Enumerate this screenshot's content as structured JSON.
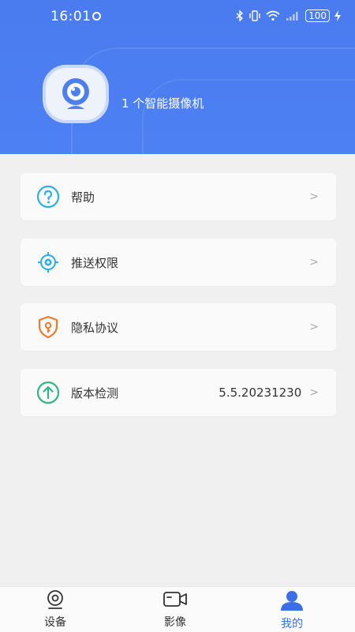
{
  "status_bar": {
    "time": "16:01",
    "battery": "100"
  },
  "header": {
    "device_count_label": "1 个智能摄像机"
  },
  "menu": {
    "items": [
      {
        "label": "帮助",
        "icon": "help-circle-icon",
        "value": ""
      },
      {
        "label": "推送权限",
        "icon": "target-icon",
        "value": ""
      },
      {
        "label": "隐私协议",
        "icon": "shield-key-icon",
        "value": ""
      },
      {
        "label": "版本检测",
        "icon": "upload-circle-icon",
        "value": "5.5.20231230"
      }
    ]
  },
  "bottom_nav": {
    "items": [
      {
        "label": "设备",
        "icon": "webcam-icon",
        "active": false
      },
      {
        "label": "影像",
        "icon": "video-camera-icon",
        "active": false
      },
      {
        "label": "我的",
        "icon": "user-icon",
        "active": true
      }
    ]
  },
  "colors": {
    "header_blue": "#4d80f2",
    "active_blue": "#3b6fe8",
    "help_icon": "#2eaee8",
    "target_icon": "#2eaee8",
    "shield_icon": "#f07a2d",
    "version_icon": "#33b585"
  }
}
